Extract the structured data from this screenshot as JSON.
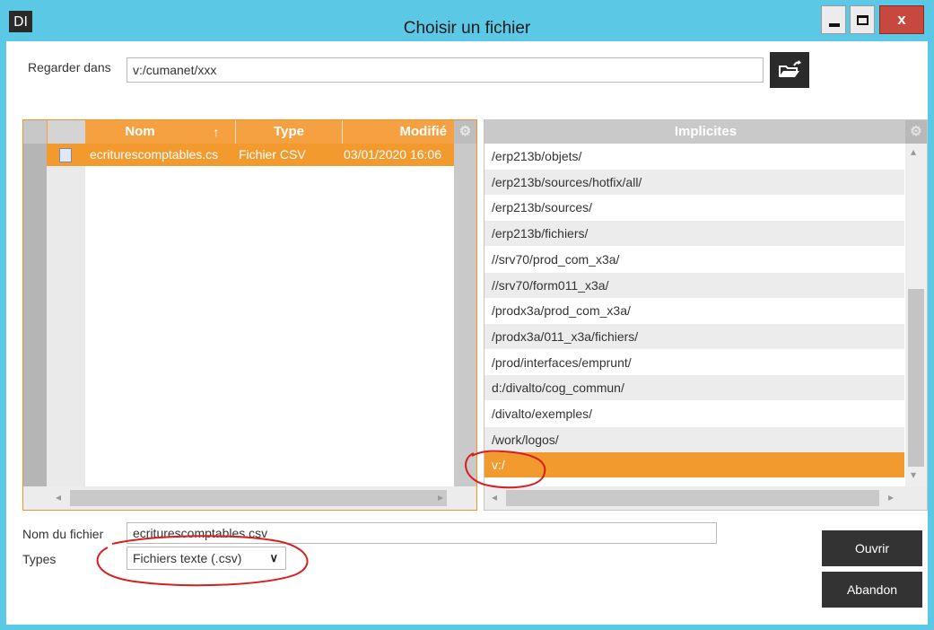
{
  "window": {
    "app_icon": "DI",
    "title": "Choisir un fichier",
    "min_glyph": "minimize-icon",
    "max_glyph": "maximize-icon",
    "close_glyph": "x"
  },
  "lookin": {
    "label": "Regarder dans",
    "value": "v:/cumanet/xxx",
    "folder_button_icon": "folder-up-icon"
  },
  "files": {
    "columns": [
      "Nom",
      "Type",
      "Modifié"
    ],
    "sort_indicator": "↑",
    "rows": [
      {
        "name": "ecriturescomptables.cs",
        "type": "Fichier CSV",
        "modified": "03/01/2020 16:06"
      }
    ]
  },
  "implicites": {
    "header": "Implicites",
    "items": [
      "/erp213b/objets/",
      "/erp213b/sources/hotfix/all/",
      "/erp213b/sources/",
      "/erp213b/fichiers/",
      "//srv70/prod_com_x3a/",
      "//srv70/form011_x3a/",
      "/prodx3a/prod_com_x3a/",
      "/prodx3a/011_x3a/fichiers/",
      "/prod/interfaces/emprunt/",
      "d:/divalto/cog_commun/",
      "/divalto/exemples/",
      "/work/logos/",
      "v:/"
    ],
    "selected_index": 12
  },
  "filename": {
    "label": "Nom du fichier",
    "value": "ecriturescomptables.csv"
  },
  "types": {
    "label": "Types",
    "value": "Fichiers texte (.csv)"
  },
  "buttons": {
    "open": "Ouvrir",
    "cancel": "Abandon"
  },
  "colors": {
    "title_bar": "#5bc8e6",
    "accent": "#f39a2e",
    "annotation": "#d81e1e"
  }
}
